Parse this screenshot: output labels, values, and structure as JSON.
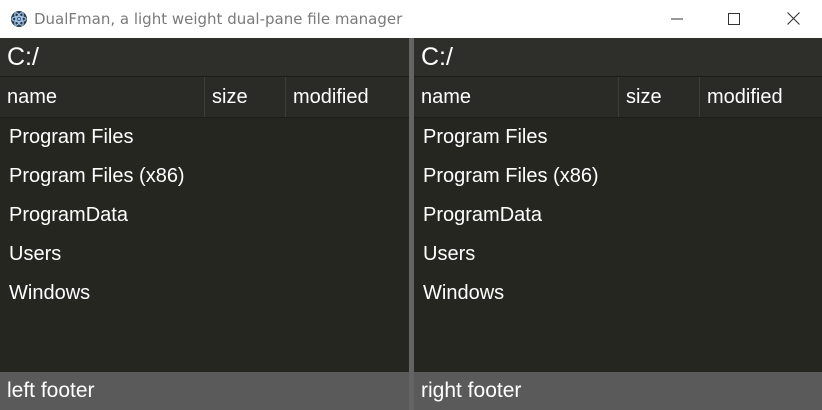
{
  "window": {
    "title": "DualFman, a light weight dual-pane file manager",
    "controls": {
      "minimize": "minimize-icon",
      "maximize": "maximize-icon",
      "close": "close-icon"
    }
  },
  "colors": {
    "background": "#262621",
    "path_bar": "#2e2e2b",
    "footer": "#5a5a5a",
    "splitter": "#646464",
    "text": "#ffffff"
  },
  "left_pane": {
    "path": "C:/",
    "columns": [
      "name",
      "size",
      "modified"
    ],
    "files": [
      "Program Files",
      "Program Files (x86)",
      "ProgramData",
      "Users",
      "Windows"
    ],
    "footer": "left footer"
  },
  "right_pane": {
    "path": "C:/",
    "columns": [
      "name",
      "size",
      "modified"
    ],
    "files": [
      "Program Files",
      "Program Files (x86)",
      "ProgramData",
      "Users",
      "Windows"
    ],
    "footer": "right footer"
  }
}
